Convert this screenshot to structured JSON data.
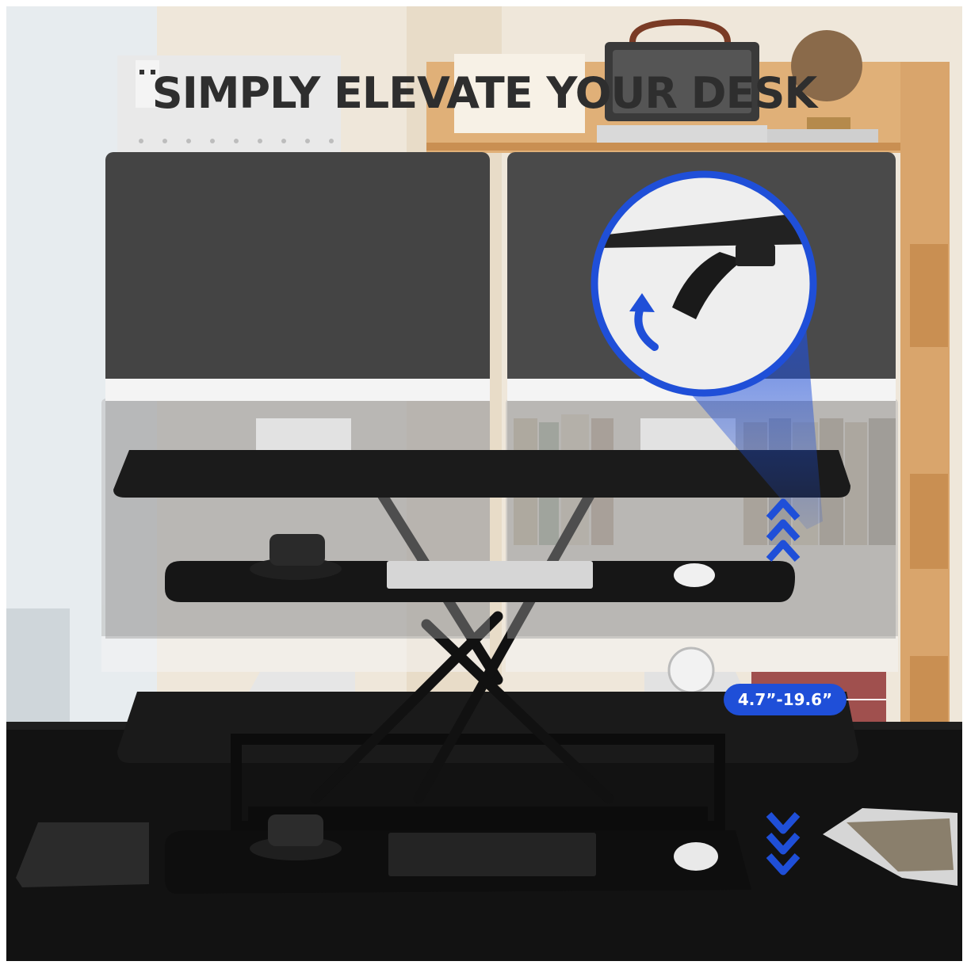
{
  "headline": "SIMPLY ELEVATE YOUR DESK",
  "height_range": "4.7”-19.6”",
  "colors": {
    "accent_blue": "#1f4fd8",
    "desk_black": "#111111",
    "wood": "#d9a56c",
    "wall": "#efe7da"
  },
  "icons": {
    "up_arrows": "chevron-up-icon",
    "down_arrows": "chevron-down-icon",
    "lift_handle": "curved-arrow-up-icon"
  }
}
